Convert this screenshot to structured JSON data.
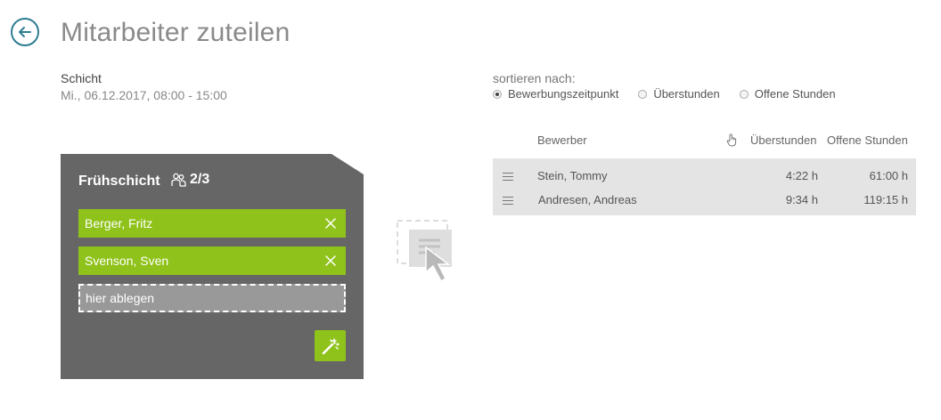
{
  "header": {
    "title": "Mitarbeiter zuteilen",
    "back_icon": "arrow-left-circle-icon",
    "accent_color": "#2f7c91"
  },
  "shift_info": {
    "label": "Schicht",
    "date": "Mi., 06.12.2017, 08:00 - 15:00"
  },
  "sort": {
    "label": "sortieren nach:",
    "options": [
      {
        "label": "Bewerbungszeitpunkt",
        "checked": true
      },
      {
        "label": "Überstunden",
        "checked": false
      },
      {
        "label": "Offene Stunden",
        "checked": false
      }
    ]
  },
  "shift_card": {
    "title": "Frühschicht",
    "count": "2/3",
    "count_icon": "people-icon",
    "assigned": [
      {
        "name": "Berger, Fritz"
      },
      {
        "name": "Svenson, Sven"
      }
    ],
    "drop_placeholder": "hier ablegen",
    "wand_icon": "magic-wand-icon",
    "card_color": "#666666",
    "assigned_color": "#8fc21a"
  },
  "applicants": {
    "headers": {
      "name": "Bewerber",
      "hand_icon": "hand-pointer-icon",
      "overtime": "Überstunden",
      "open_hours": "Offene Stunden"
    },
    "rows": [
      {
        "name": "Stein, Tommy",
        "overtime": "4:22 h",
        "open_hours": "61:00 h"
      },
      {
        "name": "Andresen, Andreas",
        "overtime": "9:34 h",
        "open_hours": "119:15 h"
      }
    ]
  }
}
